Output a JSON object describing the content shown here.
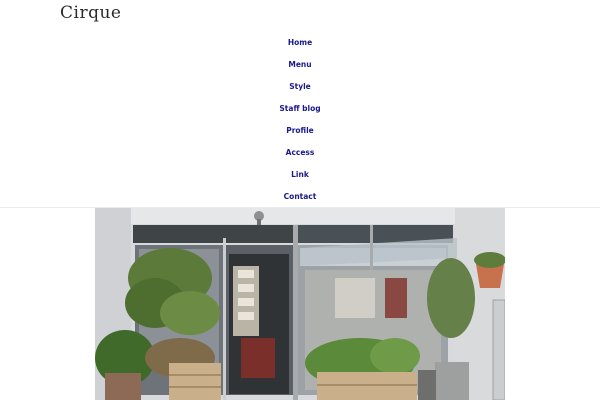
{
  "site": {
    "title": "Cirque"
  },
  "nav": {
    "items": [
      {
        "label": "Home"
      },
      {
        "label": "Menu"
      },
      {
        "label": "Style"
      },
      {
        "label": "Staff blog"
      },
      {
        "label": "Profile"
      },
      {
        "label": "Access"
      },
      {
        "label": "Link"
      },
      {
        "label": "Contact"
      }
    ]
  },
  "hero": {
    "alt_description_icon": "storefront-photo"
  },
  "colors": {
    "nav_link": "#1a1a8c",
    "title": "#2a2a2a"
  }
}
